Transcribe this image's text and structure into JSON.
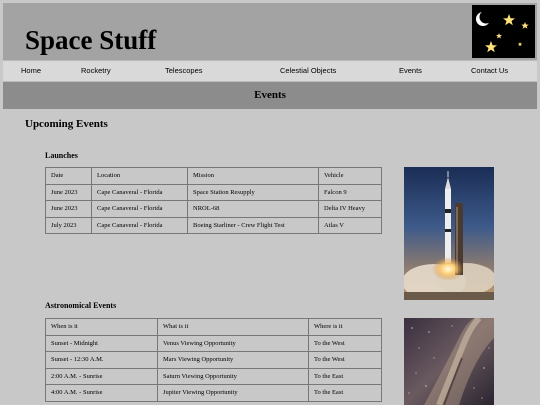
{
  "site": {
    "title": "Space Stuff"
  },
  "nav": [
    "Home",
    "Rocketry",
    "Telescopes",
    "Celestial Objects",
    "Events",
    "Contact Us"
  ],
  "section": {
    "title": "Events"
  },
  "main": {
    "heading": "Upcoming Events",
    "launches": {
      "title": "Launches",
      "headers": [
        "Date",
        "Location",
        "Mission",
        "Vehicle"
      ],
      "rows": [
        [
          "June 2023",
          "Cape Canaveral - Florida",
          "Space Station Resupply",
          "Falcon 9"
        ],
        [
          "June 2023",
          "Cape Canaveral - Florida",
          "NROL-68",
          "Delta IV Heavy"
        ],
        [
          "July 2023",
          "Cape Canaveral - Florida",
          "Boeing Starliner - Crew Flight Test",
          "Atlas V"
        ]
      ]
    },
    "astro": {
      "title": "Astronomical Events",
      "headers": [
        "When is it",
        "What is it",
        "Where is it"
      ],
      "rows": [
        [
          "Sunset - Midnight",
          "Venus Viewing Opportunity",
          "To the West"
        ],
        [
          "Sunset - 12:30 A.M.",
          "Mars Viewing Opportunity",
          "To the West"
        ],
        [
          "2:00 A.M. - Sunrise",
          "Saturn Viewing Opportunity",
          "To the East"
        ],
        [
          "4:00 A.M. - Sunrise",
          "Jupiter Viewing Opportunity",
          "To the East"
        ]
      ]
    }
  },
  "colors": {
    "page_bg": "#c8c8c8",
    "header_bg": "#a3a3a3",
    "nav_bg": "#d9d9d9",
    "section_bar": "#8c8c8c"
  },
  "icons": {
    "logo": "moon-stars-logo",
    "launch_photo": "rocket-launch-photo",
    "sky_photo": "milky-way-photo"
  }
}
